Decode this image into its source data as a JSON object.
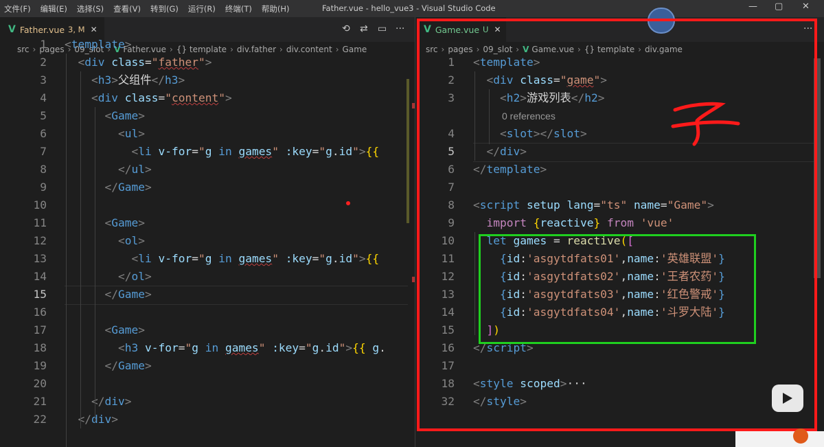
{
  "menu": [
    "文件(F)",
    "编辑(E)",
    "选择(S)",
    "查看(V)",
    "转到(G)",
    "运行(R)",
    "终端(T)",
    "帮助(H)"
  ],
  "window_title": "Father.vue - hello_vue3 - Visual Studio Code",
  "left": {
    "tab": {
      "name": "Father.vue",
      "badge": "3, M"
    },
    "breadcrumb": [
      "src",
      "pages",
      "09_slot",
      "Father.vue",
      "{} template",
      "div.father",
      "div.content",
      "Game"
    ]
  },
  "right": {
    "tab": {
      "name": "Game.vue",
      "badge": "U"
    },
    "breadcrumb": [
      "src",
      "pages",
      "09_slot",
      "Game.vue",
      "{} template",
      "div.game"
    ],
    "references": "0 references"
  },
  "annotation": "子",
  "left_code": [
    {
      "n": "1",
      "t": [
        [
          "ang",
          "<"
        ],
        [
          "tag",
          "template"
        ],
        [
          "ang",
          ">"
        ]
      ]
    },
    {
      "n": "2",
      "t": [
        [
          "plain",
          "  "
        ],
        [
          "ang",
          "<"
        ],
        [
          "tag",
          "div"
        ],
        [
          "plain",
          " "
        ],
        [
          "attr",
          "class"
        ],
        [
          "plain",
          "="
        ],
        [
          "str",
          "\""
        ],
        [
          "strw",
          "father"
        ],
        [
          "str",
          "\""
        ],
        [
          "ang",
          ">"
        ]
      ]
    },
    {
      "n": "3",
      "t": [
        [
          "plain",
          "    "
        ],
        [
          "ang",
          "<"
        ],
        [
          "tag",
          "h3"
        ],
        [
          "ang",
          ">"
        ],
        [
          "plain",
          "父组件"
        ],
        [
          "ang",
          "</"
        ],
        [
          "tag",
          "h3"
        ],
        [
          "ang",
          ">"
        ]
      ]
    },
    {
      "n": "4",
      "t": [
        [
          "plain",
          "    "
        ],
        [
          "ang",
          "<"
        ],
        [
          "tag",
          "div"
        ],
        [
          "plain",
          " "
        ],
        [
          "attr",
          "class"
        ],
        [
          "plain",
          "="
        ],
        [
          "str",
          "\""
        ],
        [
          "strw",
          "content"
        ],
        [
          "str",
          "\""
        ],
        [
          "ang",
          ">"
        ]
      ]
    },
    {
      "n": "5",
      "t": [
        [
          "plain",
          "      "
        ],
        [
          "ang",
          "<"
        ],
        [
          "tag",
          "Game"
        ],
        [
          "ang",
          ">"
        ]
      ]
    },
    {
      "n": "6",
      "t": [
        [
          "plain",
          "        "
        ],
        [
          "ang",
          "<"
        ],
        [
          "tag",
          "ul"
        ],
        [
          "ang",
          ">"
        ]
      ]
    },
    {
      "n": "7",
      "t": [
        [
          "plain",
          "          "
        ],
        [
          "ang",
          "<"
        ],
        [
          "tag",
          "li"
        ],
        [
          "plain",
          " "
        ],
        [
          "attr",
          "v-for"
        ],
        [
          "plain",
          "="
        ],
        [
          "str",
          "\""
        ],
        [
          "var",
          "g"
        ],
        [
          "plain",
          " "
        ],
        [
          "kw",
          "in"
        ],
        [
          "plain",
          " "
        ],
        [
          "varw",
          "games"
        ],
        [
          "str",
          "\""
        ],
        [
          "plain",
          " "
        ],
        [
          "attr",
          ":key"
        ],
        [
          "plain",
          "="
        ],
        [
          "str",
          "\""
        ],
        [
          "var",
          "g"
        ],
        [
          "plain",
          "."
        ],
        [
          "var",
          "id"
        ],
        [
          "str",
          "\""
        ],
        [
          "ang",
          ">"
        ],
        [
          "ybrace",
          "{{"
        ]
      ]
    },
    {
      "n": "8",
      "t": [
        [
          "plain",
          "        "
        ],
        [
          "ang",
          "</"
        ],
        [
          "tag",
          "ul"
        ],
        [
          "ang",
          ">"
        ]
      ]
    },
    {
      "n": "9",
      "t": [
        [
          "plain",
          "      "
        ],
        [
          "ang",
          "</"
        ],
        [
          "tag",
          "Game"
        ],
        [
          "ang",
          ">"
        ]
      ]
    },
    {
      "n": "10",
      "t": []
    },
    {
      "n": "11",
      "t": [
        [
          "plain",
          "      "
        ],
        [
          "ang",
          "<"
        ],
        [
          "tag",
          "Game"
        ],
        [
          "ang",
          ">"
        ]
      ]
    },
    {
      "n": "12",
      "t": [
        [
          "plain",
          "        "
        ],
        [
          "ang",
          "<"
        ],
        [
          "tag",
          "ol"
        ],
        [
          "ang",
          ">"
        ]
      ]
    },
    {
      "n": "13",
      "t": [
        [
          "plain",
          "          "
        ],
        [
          "ang",
          "<"
        ],
        [
          "tag",
          "li"
        ],
        [
          "plain",
          " "
        ],
        [
          "attr",
          "v-for"
        ],
        [
          "plain",
          "="
        ],
        [
          "str",
          "\""
        ],
        [
          "var",
          "g"
        ],
        [
          "plain",
          " "
        ],
        [
          "kw",
          "in"
        ],
        [
          "plain",
          " "
        ],
        [
          "varw",
          "games"
        ],
        [
          "str",
          "\""
        ],
        [
          "plain",
          " "
        ],
        [
          "attr",
          ":key"
        ],
        [
          "plain",
          "="
        ],
        [
          "str",
          "\""
        ],
        [
          "var",
          "g"
        ],
        [
          "plain",
          "."
        ],
        [
          "var",
          "id"
        ],
        [
          "str",
          "\""
        ],
        [
          "ang",
          ">"
        ],
        [
          "ybrace",
          "{{"
        ]
      ]
    },
    {
      "n": "14",
      "t": [
        [
          "plain",
          "        "
        ],
        [
          "ang",
          "</"
        ],
        [
          "tag",
          "ol"
        ],
        [
          "ang",
          ">"
        ]
      ]
    },
    {
      "n": "15",
      "t": [
        [
          "plain",
          "      "
        ],
        [
          "ang",
          "</"
        ],
        [
          "tag",
          "Game"
        ],
        [
          "ang",
          ">"
        ]
      ]
    },
    {
      "n": "16",
      "t": []
    },
    {
      "n": "17",
      "t": [
        [
          "plain",
          "      "
        ],
        [
          "ang",
          "<"
        ],
        [
          "tag",
          "Game"
        ],
        [
          "ang",
          ">"
        ]
      ]
    },
    {
      "n": "18",
      "t": [
        [
          "plain",
          "        "
        ],
        [
          "ang",
          "<"
        ],
        [
          "tag",
          "h3"
        ],
        [
          "plain",
          " "
        ],
        [
          "attr",
          "v-for"
        ],
        [
          "plain",
          "="
        ],
        [
          "str",
          "\""
        ],
        [
          "var",
          "g"
        ],
        [
          "plain",
          " "
        ],
        [
          "kw",
          "in"
        ],
        [
          "plain",
          " "
        ],
        [
          "varw",
          "games"
        ],
        [
          "str",
          "\""
        ],
        [
          "plain",
          " "
        ],
        [
          "attr",
          ":key"
        ],
        [
          "plain",
          "="
        ],
        [
          "str",
          "\""
        ],
        [
          "var",
          "g"
        ],
        [
          "plain",
          "."
        ],
        [
          "var",
          "id"
        ],
        [
          "str",
          "\""
        ],
        [
          "ang",
          ">"
        ],
        [
          "ybrace",
          "{{"
        ],
        [
          "plain",
          " "
        ],
        [
          "var",
          "g"
        ],
        [
          "plain",
          "."
        ]
      ]
    },
    {
      "n": "19",
      "t": [
        [
          "plain",
          "      "
        ],
        [
          "ang",
          "</"
        ],
        [
          "tag",
          "Game"
        ],
        [
          "ang",
          ">"
        ]
      ]
    },
    {
      "n": "20",
      "t": []
    },
    {
      "n": "21",
      "t": [
        [
          "plain",
          "    "
        ],
        [
          "ang",
          "</"
        ],
        [
          "tag",
          "div"
        ],
        [
          "ang",
          ">"
        ]
      ]
    },
    {
      "n": "22",
      "t": [
        [
          "plain",
          "  "
        ],
        [
          "ang",
          "</"
        ],
        [
          "tag",
          "div"
        ],
        [
          "ang",
          ">"
        ]
      ]
    }
  ],
  "right_code": [
    {
      "n": "1",
      "t": [
        [
          "ang",
          "<"
        ],
        [
          "tag",
          "template"
        ],
        [
          "ang",
          ">"
        ]
      ]
    },
    {
      "n": "2",
      "t": [
        [
          "plain",
          "  "
        ],
        [
          "ang",
          "<"
        ],
        [
          "tag",
          "div"
        ],
        [
          "plain",
          " "
        ],
        [
          "attr",
          "class"
        ],
        [
          "plain",
          "="
        ],
        [
          "str",
          "\""
        ],
        [
          "strw",
          "game"
        ],
        [
          "str",
          "\""
        ],
        [
          "ang",
          ">"
        ]
      ]
    },
    {
      "n": "3",
      "t": [
        [
          "plain",
          "    "
        ],
        [
          "ang",
          "<"
        ],
        [
          "tag",
          "h2"
        ],
        [
          "ang",
          ">"
        ],
        [
          "plain",
          "游戏列表"
        ],
        [
          "ang",
          "</"
        ],
        [
          "tag",
          "h2"
        ],
        [
          "ang",
          ">"
        ]
      ]
    },
    {
      "n": "",
      "ref": true,
      "t": []
    },
    {
      "n": "4",
      "t": [
        [
          "plain",
          "    "
        ],
        [
          "ang",
          "<"
        ],
        [
          "tag",
          "slot"
        ],
        [
          "ang",
          "></"
        ],
        [
          "tag",
          "slot"
        ],
        [
          "ang",
          ">"
        ]
      ]
    },
    {
      "n": "5",
      "t": [
        [
          "plain",
          "  "
        ],
        [
          "ang",
          "</"
        ],
        [
          "tag",
          "div"
        ],
        [
          "ang",
          ">"
        ]
      ]
    },
    {
      "n": "6",
      "t": [
        [
          "ang",
          "</"
        ],
        [
          "tag",
          "template"
        ],
        [
          "ang",
          ">"
        ]
      ]
    },
    {
      "n": "7",
      "t": []
    },
    {
      "n": "8",
      "t": [
        [
          "ang",
          "<"
        ],
        [
          "tag",
          "script"
        ],
        [
          "plain",
          " "
        ],
        [
          "attr",
          "setup"
        ],
        [
          "plain",
          " "
        ],
        [
          "attr",
          "lang"
        ],
        [
          "plain",
          "="
        ],
        [
          "str",
          "\"ts\""
        ],
        [
          "plain",
          " "
        ],
        [
          "attr",
          "name"
        ],
        [
          "plain",
          "="
        ],
        [
          "str",
          "\"Game\""
        ],
        [
          "ang",
          ">"
        ]
      ]
    },
    {
      "n": "9",
      "t": [
        [
          "plain",
          "  "
        ],
        [
          "ctrl",
          "import"
        ],
        [
          "plain",
          " "
        ],
        [
          "ybrace",
          "{"
        ],
        [
          "var",
          "reactive"
        ],
        [
          "ybrace",
          "}"
        ],
        [
          "plain",
          " "
        ],
        [
          "ctrl",
          "from"
        ],
        [
          "plain",
          " "
        ],
        [
          "str",
          "'vue'"
        ]
      ]
    },
    {
      "n": "10",
      "t": [
        [
          "plain",
          "  "
        ],
        [
          "kw",
          "let"
        ],
        [
          "plain",
          " "
        ],
        [
          "var",
          "games"
        ],
        [
          "plain",
          " = "
        ],
        [
          "fn",
          "reactive"
        ],
        [
          "ybrace",
          "("
        ],
        [
          "brace",
          "["
        ]
      ]
    },
    {
      "n": "11",
      "t": [
        [
          "plain",
          "    "
        ],
        [
          "bl",
          "{"
        ],
        [
          "var",
          "id"
        ],
        [
          "plain",
          ":"
        ],
        [
          "str",
          "'asgytdfats01'"
        ],
        [
          "plain",
          ","
        ],
        [
          "var",
          "name"
        ],
        [
          "plain",
          ":"
        ],
        [
          "str",
          "'英雄联盟'"
        ],
        [
          "bl",
          "}"
        ]
      ]
    },
    {
      "n": "12",
      "t": [
        [
          "plain",
          "    "
        ],
        [
          "bl",
          "{"
        ],
        [
          "var",
          "id"
        ],
        [
          "plain",
          ":"
        ],
        [
          "str",
          "'asgytdfats02'"
        ],
        [
          "plain",
          ","
        ],
        [
          "var",
          "name"
        ],
        [
          "plain",
          ":"
        ],
        [
          "str",
          "'王者农药'"
        ],
        [
          "bl",
          "}"
        ]
      ]
    },
    {
      "n": "13",
      "t": [
        [
          "plain",
          "    "
        ],
        [
          "bl",
          "{"
        ],
        [
          "var",
          "id"
        ],
        [
          "plain",
          ":"
        ],
        [
          "str",
          "'asgytdfats03'"
        ],
        [
          "plain",
          ","
        ],
        [
          "var",
          "name"
        ],
        [
          "plain",
          ":"
        ],
        [
          "str",
          "'红色警戒'"
        ],
        [
          "bl",
          "}"
        ]
      ]
    },
    {
      "n": "14",
      "t": [
        [
          "plain",
          "    "
        ],
        [
          "bl",
          "{"
        ],
        [
          "var",
          "id"
        ],
        [
          "plain",
          ":"
        ],
        [
          "str",
          "'asgytdfats04'"
        ],
        [
          "plain",
          ","
        ],
        [
          "var",
          "name"
        ],
        [
          "plain",
          ":"
        ],
        [
          "str",
          "'斗罗大陆'"
        ],
        [
          "bl",
          "}"
        ]
      ]
    },
    {
      "n": "15",
      "t": [
        [
          "plain",
          "  "
        ],
        [
          "brace",
          "]"
        ],
        [
          "ybrace",
          ")"
        ]
      ]
    },
    {
      "n": "16",
      "t": [
        [
          "ang",
          "</"
        ],
        [
          "tag",
          "script"
        ],
        [
          "ang",
          ">"
        ]
      ]
    },
    {
      "n": "17",
      "t": []
    },
    {
      "n": "18",
      "t": [
        [
          "ang",
          "<"
        ],
        [
          "tag",
          "style"
        ],
        [
          "plain",
          " "
        ],
        [
          "attr",
          "scoped"
        ],
        [
          "ang",
          ">"
        ],
        [
          "plain",
          "···"
        ]
      ]
    },
    {
      "n": "32",
      "t": [
        [
          "ang",
          "</"
        ],
        [
          "tag",
          "style"
        ],
        [
          "ang",
          ">"
        ]
      ]
    }
  ]
}
